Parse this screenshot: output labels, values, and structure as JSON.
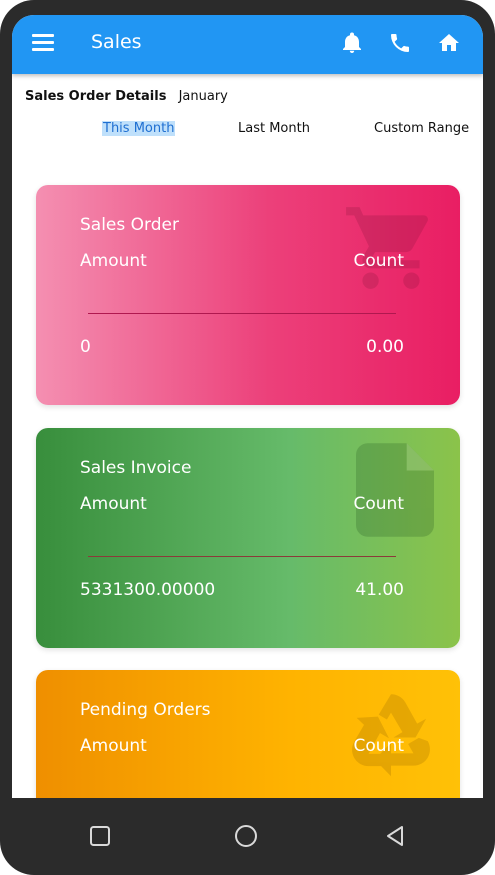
{
  "app_bar": {
    "title": "Sales",
    "icons": [
      "menu-icon",
      "bell-icon",
      "phone-icon",
      "home-icon"
    ],
    "color": "#2196f3"
  },
  "details": {
    "label": "Sales Order Details",
    "month": "January"
  },
  "range_tabs": [
    {
      "label": "This Month",
      "selected": true
    },
    {
      "label": "Last Month",
      "selected": false
    },
    {
      "label": "Custom Range",
      "selected": false
    }
  ],
  "cards": {
    "sales_order": {
      "title": "Sales Order",
      "amount_label": "Amount",
      "count_label": "Count",
      "amount_value": "0",
      "count_value": "0.00",
      "icon": "cart-icon"
    },
    "sales_invoice": {
      "title": "Sales Invoice",
      "amount_label": "Amount",
      "count_label": "Count",
      "amount_value": "5331300.00000",
      "count_value": "41.00",
      "icon": "document-icon"
    },
    "pending_orders": {
      "title": "Pending Orders",
      "amount_label": "Amount",
      "count_label": "Count",
      "icon": "recycle-icon"
    }
  },
  "system_nav": {
    "icons": [
      "recents-square-icon",
      "home-circle-icon",
      "back-triangle-icon"
    ]
  }
}
